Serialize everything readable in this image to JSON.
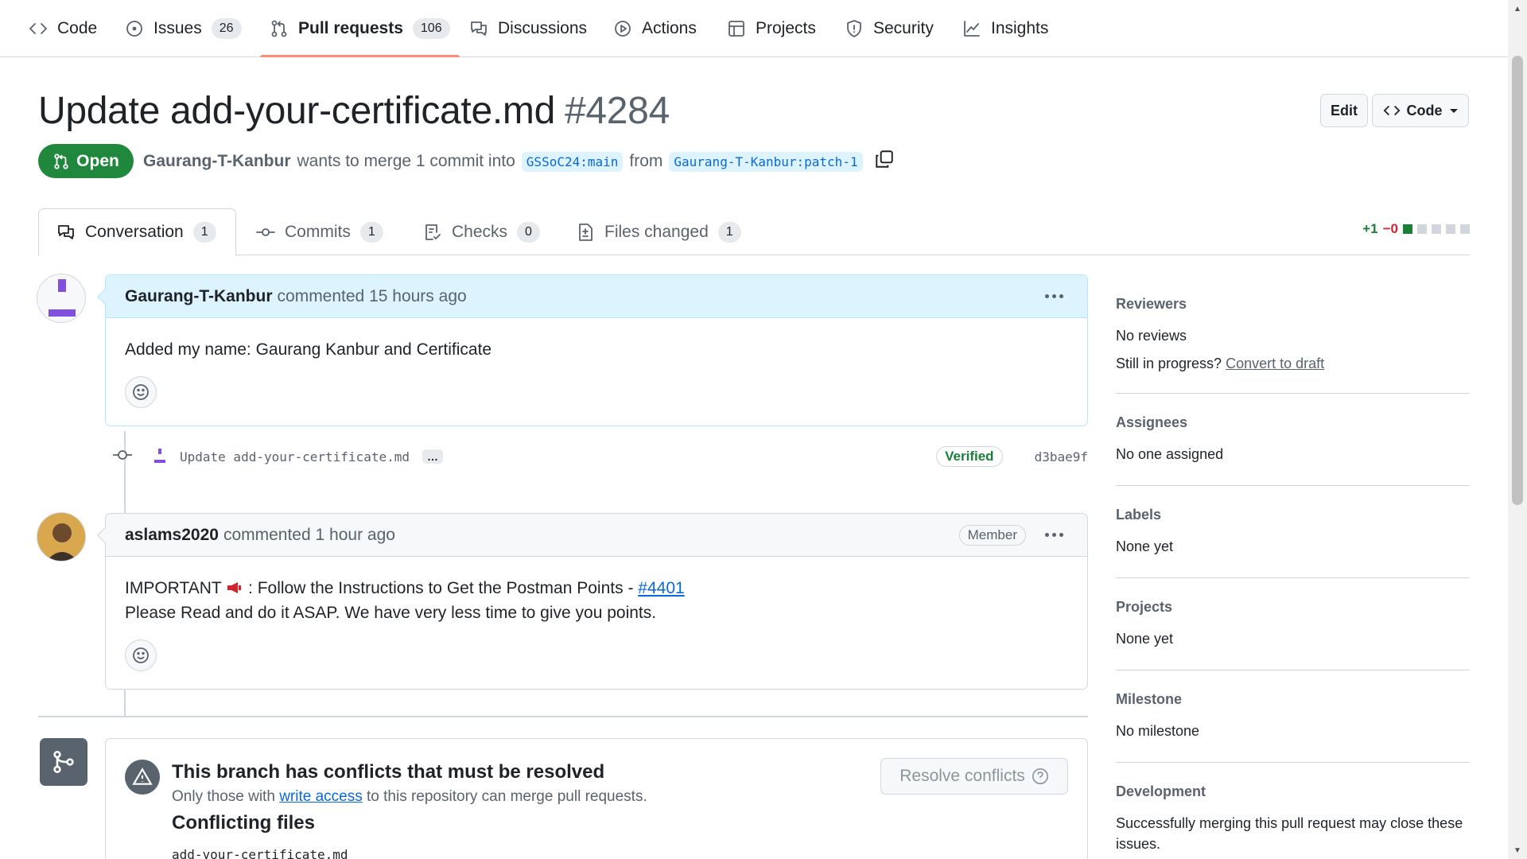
{
  "nav": {
    "items": [
      {
        "label": "Code",
        "count": ""
      },
      {
        "label": "Issues",
        "count": "26"
      },
      {
        "label": "Pull requests",
        "count": "106"
      },
      {
        "label": "Discussions",
        "count": ""
      },
      {
        "label": "Actions",
        "count": ""
      },
      {
        "label": "Projects",
        "count": ""
      },
      {
        "label": "Security",
        "count": ""
      },
      {
        "label": "Insights",
        "count": ""
      }
    ],
    "active": "Pull requests"
  },
  "pr": {
    "title": "Update add-your-certificate.md",
    "number": "#4284",
    "state": "Open",
    "author": "Gaurang-T-Kanbur",
    "merge_text": "wants to merge 1 commit into",
    "base_branch": "GSSoC24:main",
    "from_text": "from",
    "head_branch": "Gaurang-T-Kanbur:patch-1"
  },
  "header_buttons": {
    "edit": "Edit",
    "code": "Code"
  },
  "tabs": [
    {
      "label": "Conversation",
      "count": "1"
    },
    {
      "label": "Commits",
      "count": "1"
    },
    {
      "label": "Checks",
      "count": "0"
    },
    {
      "label": "Files changed",
      "count": "1"
    }
  ],
  "diffstat": {
    "additions": "+1",
    "deletions": "−0"
  },
  "colors": {
    "accent_open": "#1f883d",
    "link": "#0969da",
    "addition": "#1a7f37",
    "deletion": "#d1242f"
  },
  "timeline": {
    "comment1": {
      "user": "Gaurang-T-Kanbur",
      "action": "commented",
      "time": "15 hours ago",
      "body": "Added my name: Gaurang Kanbur and Certificate"
    },
    "commit": {
      "message": "Update add-your-certificate.md",
      "ellipsis": "…",
      "verified": "Verified",
      "sha": "d3bae9f"
    },
    "comment2": {
      "user": "aslams2020",
      "action": "commented",
      "time": "1 hour ago",
      "badge": "Member",
      "line1_prefix": "IMPORTANT",
      "line1_middle": ": Follow the Instructions to Get the Postman Points -",
      "line1_link": "#4401",
      "line2": "Please Read and do it ASAP. We have very less time to give you points."
    }
  },
  "merge_box": {
    "title": "This branch has conflicts that must be resolved",
    "sub_prefix": "Only those with",
    "sub_link": "write access",
    "sub_suffix": "to this repository can merge pull requests.",
    "files_title": "Conflicting files",
    "file": "add-your-certificate.md",
    "resolve_button": "Resolve conflicts"
  },
  "sidebar": {
    "reviewers": {
      "heading": "Reviewers",
      "value": "No reviews",
      "extra_prefix": "Still in progress?",
      "extra_link": "Convert to draft"
    },
    "assignees": {
      "heading": "Assignees",
      "value": "No one assigned"
    },
    "labels": {
      "heading": "Labels",
      "value": "None yet"
    },
    "projects": {
      "heading": "Projects",
      "value": "None yet"
    },
    "milestone": {
      "heading": "Milestone",
      "value": "No milestone"
    },
    "development": {
      "heading": "Development",
      "value": "Successfully merging this pull request may close these issues."
    }
  }
}
